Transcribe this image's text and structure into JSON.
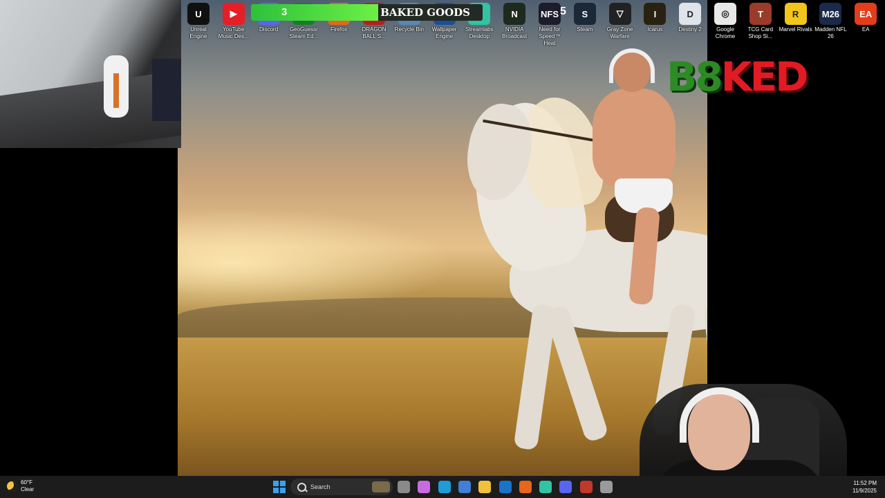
{
  "overlay": {
    "progress_value": "3",
    "progress_title": "BAKED GOODS",
    "progress_fraction": 0.55,
    "badge_value": "5"
  },
  "logo": {
    "text_part1": "B8",
    "text_part2": "KED"
  },
  "desktop_icons": [
    {
      "label": "Unreal Engine",
      "color": "#101010",
      "glyph": "U"
    },
    {
      "label": "YouTube Music Des...",
      "color": "#e61e25",
      "glyph": "▶"
    },
    {
      "label": "Discord",
      "color": "#5865f2",
      "glyph": "D"
    },
    {
      "label": "GeoGuessr Steam Ed...",
      "color": "#1b7a2a",
      "glyph": "G"
    },
    {
      "label": "Firefox",
      "color": "#e8651c",
      "glyph": "F"
    },
    {
      "label": "DRAGON BALL S...",
      "color": "#b81d1d",
      "glyph": "D"
    },
    {
      "label": "Recycle Bin",
      "color": "#5a87b5",
      "glyph": "♻"
    },
    {
      "label": "Wallpaper Engine",
      "color": "#1a4f9c",
      "glyph": "W"
    },
    {
      "label": "Streamlabs Desktop",
      "color": "#31c3a2",
      "glyph": "S"
    },
    {
      "label": "NVIDIA Broadcast",
      "color": "#1f2a1f",
      "glyph": "N"
    },
    {
      "label": "Need for Speed™ Heat",
      "color": "#1c1c2c",
      "glyph": "NFS"
    },
    {
      "label": "Steam",
      "color": "#1b2838",
      "glyph": "S"
    },
    {
      "label": "Gray Zone Warfare",
      "color": "#222222",
      "glyph": "▽"
    },
    {
      "label": "Icarus",
      "color": "#2a2210",
      "glyph": "I"
    },
    {
      "label": "Destiny 2",
      "color": "#dfe3ea",
      "glyph": "D"
    },
    {
      "label": "Google Chrome",
      "color": "#e8e8e8",
      "glyph": "◎"
    },
    {
      "label": "TCG Card Shop Si...",
      "color": "#9b3b2a",
      "glyph": "T"
    },
    {
      "label": "Marvel Rivals",
      "color": "#f2c51b",
      "glyph": "R"
    },
    {
      "label": "Madden NFL 26",
      "color": "#1a2a48",
      "glyph": "M26"
    },
    {
      "label": "EA",
      "color": "#e43d1b",
      "glyph": "EA"
    }
  ],
  "taskbar": {
    "weather_temp": "60°F",
    "weather_cond": "Clear",
    "search_placeholder": "Search",
    "time": "11:52 PM",
    "date": "11/9/2025",
    "apps": [
      {
        "name": "task-view-icon",
        "color": "#8a8a8a"
      },
      {
        "name": "copilot-icon",
        "color": "#c86be0"
      },
      {
        "name": "edge-icon",
        "color": "#1f9bd8"
      },
      {
        "name": "store-icon",
        "color": "#3f7fd8"
      },
      {
        "name": "file-explorer-icon",
        "color": "#f2c13b"
      },
      {
        "name": "outlook-icon",
        "color": "#1a73c8"
      },
      {
        "name": "firefox-icon",
        "color": "#e8651c"
      },
      {
        "name": "streamlabs-icon",
        "color": "#31c3a2"
      },
      {
        "name": "discord-icon",
        "color": "#5865f2"
      },
      {
        "name": "tcg-icon",
        "color": "#c0392b"
      },
      {
        "name": "settings-icon",
        "color": "#9a9a9a"
      }
    ]
  }
}
